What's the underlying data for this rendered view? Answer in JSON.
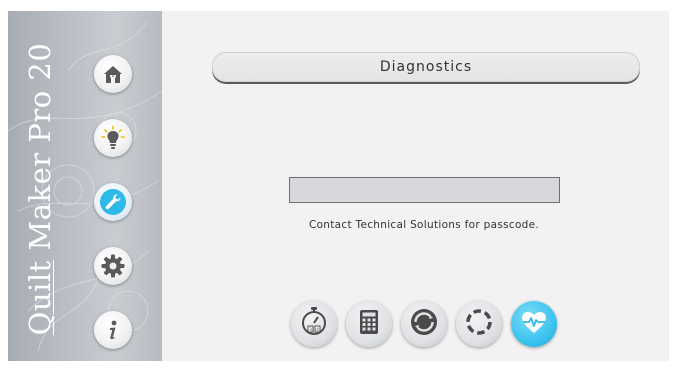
{
  "app": {
    "brand_first": "Quilt",
    "brand_rest": " Maker Pro 20"
  },
  "sidebar": {
    "items": [
      {
        "name": "home",
        "icon": "home-icon",
        "active": false
      },
      {
        "name": "tips",
        "icon": "lightbulb-icon",
        "active": false
      },
      {
        "name": "tools",
        "icon": "wrench-icon",
        "active": true
      },
      {
        "name": "settings",
        "icon": "gear-icon",
        "active": false
      },
      {
        "name": "info",
        "icon": "info-icon",
        "active": false
      }
    ]
  },
  "main": {
    "title": "Diagnostics",
    "passcode": {
      "value": "",
      "placeholder": ""
    },
    "hint": "Contact Technical Solutions for passcode."
  },
  "toolbar": {
    "items": [
      {
        "name": "timer",
        "icon": "stopwatch-icon",
        "active": false
      },
      {
        "name": "calculator",
        "icon": "calculator-icon",
        "active": false
      },
      {
        "name": "sync",
        "icon": "sync-icon",
        "active": false
      },
      {
        "name": "progress",
        "icon": "progress-ring-icon",
        "active": false
      },
      {
        "name": "diagnostics",
        "icon": "heartbeat-icon",
        "active": true
      }
    ]
  },
  "colors": {
    "accent": "#2fb8ea",
    "icon_gray": "#5a5a5a",
    "sidebar": "#b9bdc3",
    "background": "#f2f2f2"
  }
}
